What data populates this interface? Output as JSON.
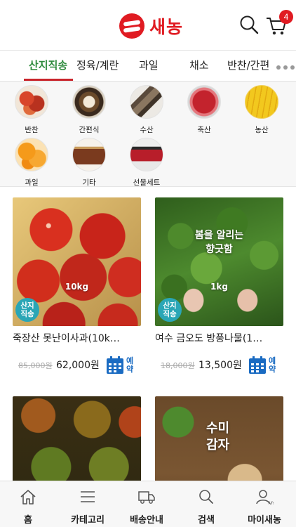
{
  "header": {
    "logo_text": "새농",
    "cart_count": "4",
    "accent": "#e01b22"
  },
  "tabs": [
    {
      "label": "산지직송",
      "active": true
    },
    {
      "label": "정육/계란"
    },
    {
      "label": "과일"
    },
    {
      "label": "채소"
    },
    {
      "label": "반찬/간편"
    }
  ],
  "categories": [
    {
      "label": "반찬"
    },
    {
      "label": "간편식"
    },
    {
      "label": "수산"
    },
    {
      "label": "축산"
    },
    {
      "label": "농산"
    },
    {
      "label": "과일"
    },
    {
      "label": "기타"
    },
    {
      "label": "선물세트"
    }
  ],
  "products": [
    {
      "name": "죽장산 못난이사과(10k…",
      "weight": "10kg",
      "overlay": "",
      "badge": "산지\n직송",
      "price_old": "85,000원",
      "price_new": "62,000원",
      "reserve": "예약"
    },
    {
      "name": "여수 금오도 방풍나물(1…",
      "weight": "1kg",
      "overlay": "봄을 알리는\n향긋함",
      "badge": "산지\n직송",
      "price_old": "18,000원",
      "price_new": "13,500원",
      "reserve": "예약"
    },
    {
      "name": "",
      "weight": "",
      "overlay": ""
    },
    {
      "name": "",
      "weight": "",
      "overlay": "수미\n감자"
    }
  ],
  "bottom_nav": [
    {
      "label": "홈",
      "icon": "home-icon"
    },
    {
      "label": "카테고리",
      "icon": "menu-icon"
    },
    {
      "label": "배송안내",
      "icon": "truck-icon"
    },
    {
      "label": "검색",
      "icon": "search-icon"
    },
    {
      "label": "마이새농",
      "icon": "user-icon"
    }
  ],
  "colors": {
    "brand_red": "#e01b22",
    "tab_active": "#2e8b3d",
    "badge_teal": "#2aa6b6",
    "reserve_blue": "#1a6bc2"
  }
}
